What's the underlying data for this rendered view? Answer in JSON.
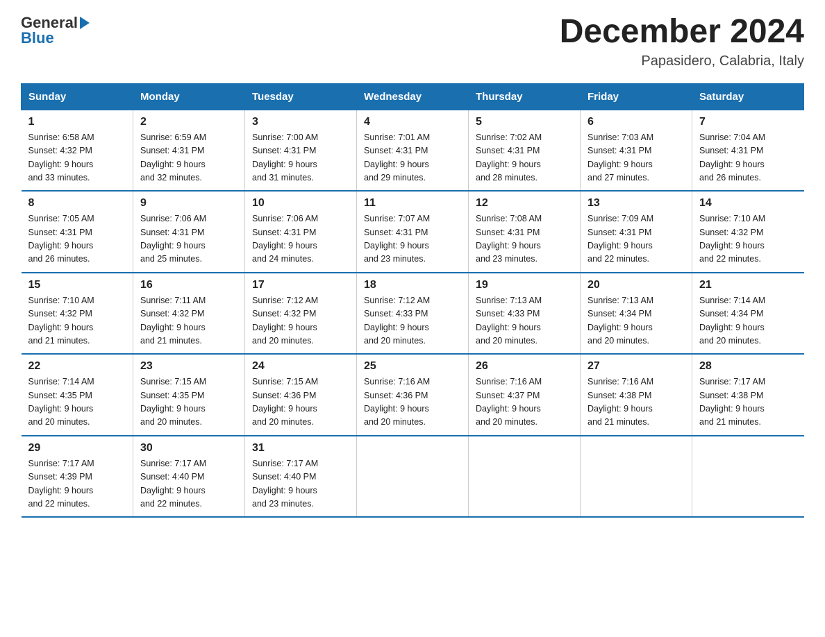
{
  "header": {
    "logo_text_general": "General",
    "logo_text_blue": "Blue",
    "month_title": "December 2024",
    "location": "Papasidero, Calabria, Italy"
  },
  "days_of_week": [
    "Sunday",
    "Monday",
    "Tuesday",
    "Wednesday",
    "Thursday",
    "Friday",
    "Saturday"
  ],
  "weeks": [
    [
      {
        "day": "1",
        "sunrise": "6:58 AM",
        "sunset": "4:32 PM",
        "daylight": "9 hours and 33 minutes."
      },
      {
        "day": "2",
        "sunrise": "6:59 AM",
        "sunset": "4:31 PM",
        "daylight": "9 hours and 32 minutes."
      },
      {
        "day": "3",
        "sunrise": "7:00 AM",
        "sunset": "4:31 PM",
        "daylight": "9 hours and 31 minutes."
      },
      {
        "day": "4",
        "sunrise": "7:01 AM",
        "sunset": "4:31 PM",
        "daylight": "9 hours and 29 minutes."
      },
      {
        "day": "5",
        "sunrise": "7:02 AM",
        "sunset": "4:31 PM",
        "daylight": "9 hours and 28 minutes."
      },
      {
        "day": "6",
        "sunrise": "7:03 AM",
        "sunset": "4:31 PM",
        "daylight": "9 hours and 27 minutes."
      },
      {
        "day": "7",
        "sunrise": "7:04 AM",
        "sunset": "4:31 PM",
        "daylight": "9 hours and 26 minutes."
      }
    ],
    [
      {
        "day": "8",
        "sunrise": "7:05 AM",
        "sunset": "4:31 PM",
        "daylight": "9 hours and 26 minutes."
      },
      {
        "day": "9",
        "sunrise": "7:06 AM",
        "sunset": "4:31 PM",
        "daylight": "9 hours and 25 minutes."
      },
      {
        "day": "10",
        "sunrise": "7:06 AM",
        "sunset": "4:31 PM",
        "daylight": "9 hours and 24 minutes."
      },
      {
        "day": "11",
        "sunrise": "7:07 AM",
        "sunset": "4:31 PM",
        "daylight": "9 hours and 23 minutes."
      },
      {
        "day": "12",
        "sunrise": "7:08 AM",
        "sunset": "4:31 PM",
        "daylight": "9 hours and 23 minutes."
      },
      {
        "day": "13",
        "sunrise": "7:09 AM",
        "sunset": "4:31 PM",
        "daylight": "9 hours and 22 minutes."
      },
      {
        "day": "14",
        "sunrise": "7:10 AM",
        "sunset": "4:32 PM",
        "daylight": "9 hours and 22 minutes."
      }
    ],
    [
      {
        "day": "15",
        "sunrise": "7:10 AM",
        "sunset": "4:32 PM",
        "daylight": "9 hours and 21 minutes."
      },
      {
        "day": "16",
        "sunrise": "7:11 AM",
        "sunset": "4:32 PM",
        "daylight": "9 hours and 21 minutes."
      },
      {
        "day": "17",
        "sunrise": "7:12 AM",
        "sunset": "4:32 PM",
        "daylight": "9 hours and 20 minutes."
      },
      {
        "day": "18",
        "sunrise": "7:12 AM",
        "sunset": "4:33 PM",
        "daylight": "9 hours and 20 minutes."
      },
      {
        "day": "19",
        "sunrise": "7:13 AM",
        "sunset": "4:33 PM",
        "daylight": "9 hours and 20 minutes."
      },
      {
        "day": "20",
        "sunrise": "7:13 AM",
        "sunset": "4:34 PM",
        "daylight": "9 hours and 20 minutes."
      },
      {
        "day": "21",
        "sunrise": "7:14 AM",
        "sunset": "4:34 PM",
        "daylight": "9 hours and 20 minutes."
      }
    ],
    [
      {
        "day": "22",
        "sunrise": "7:14 AM",
        "sunset": "4:35 PM",
        "daylight": "9 hours and 20 minutes."
      },
      {
        "day": "23",
        "sunrise": "7:15 AM",
        "sunset": "4:35 PM",
        "daylight": "9 hours and 20 minutes."
      },
      {
        "day": "24",
        "sunrise": "7:15 AM",
        "sunset": "4:36 PM",
        "daylight": "9 hours and 20 minutes."
      },
      {
        "day": "25",
        "sunrise": "7:16 AM",
        "sunset": "4:36 PM",
        "daylight": "9 hours and 20 minutes."
      },
      {
        "day": "26",
        "sunrise": "7:16 AM",
        "sunset": "4:37 PM",
        "daylight": "9 hours and 20 minutes."
      },
      {
        "day": "27",
        "sunrise": "7:16 AM",
        "sunset": "4:38 PM",
        "daylight": "9 hours and 21 minutes."
      },
      {
        "day": "28",
        "sunrise": "7:17 AM",
        "sunset": "4:38 PM",
        "daylight": "9 hours and 21 minutes."
      }
    ],
    [
      {
        "day": "29",
        "sunrise": "7:17 AM",
        "sunset": "4:39 PM",
        "daylight": "9 hours and 22 minutes."
      },
      {
        "day": "30",
        "sunrise": "7:17 AM",
        "sunset": "4:40 PM",
        "daylight": "9 hours and 22 minutes."
      },
      {
        "day": "31",
        "sunrise": "7:17 AM",
        "sunset": "4:40 PM",
        "daylight": "9 hours and 23 minutes."
      },
      null,
      null,
      null,
      null
    ]
  ],
  "labels": {
    "sunrise": "Sunrise:",
    "sunset": "Sunset:",
    "daylight": "Daylight:"
  }
}
